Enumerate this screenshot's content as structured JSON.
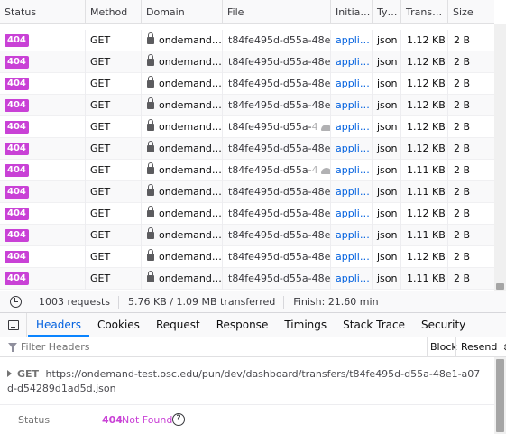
{
  "columns": {
    "status": "Status",
    "method": "Method",
    "domain": "Domain",
    "file": "File",
    "initiator": "Initia…",
    "type": "Ty…",
    "transferred": "Trans…",
    "size": "Size"
  },
  "rows": [
    {
      "status": "404",
      "method": "GET",
      "domain": "ondemand…",
      "file": "t84fe495d-d55a-48e1-",
      "initiator": "appli…",
      "type": "json",
      "transferred": "1.12 KB",
      "size": "2 B"
    },
    {
      "status": "404",
      "method": "GET",
      "domain": "ondemand…",
      "file": "t84fe495d-d55a-48e1-",
      "initiator": "appli…",
      "type": "json",
      "transferred": "1.12 KB",
      "size": "2 B"
    },
    {
      "status": "404",
      "method": "GET",
      "domain": "ondemand…",
      "file": "t84fe495d-d55a-48e1-",
      "initiator": "appli…",
      "type": "json",
      "transferred": "1.12 KB",
      "size": "2 B"
    },
    {
      "status": "404",
      "method": "GET",
      "domain": "ondemand…",
      "file": "t84fe495d-d55a-48e1-",
      "initiator": "appli…",
      "type": "json",
      "transferred": "1.12 KB",
      "size": "2 B"
    },
    {
      "status": "404",
      "method": "GET",
      "domain": "ondemand…",
      "file": "t84fe495d-d55a-",
      "file_faded": "4",
      "initiator": "appli…",
      "type": "json",
      "transferred": "1.12 KB",
      "size": "2 B"
    },
    {
      "status": "404",
      "method": "GET",
      "domain": "ondemand…",
      "file": "t84fe495d-d55a-48e1-",
      "initiator": "appli…",
      "type": "json",
      "transferred": "1.12 KB",
      "size": "2 B"
    },
    {
      "status": "404",
      "method": "GET",
      "domain": "ondemand…",
      "file": "t84fe495d-d55a-",
      "file_faded": "4",
      "initiator": "appli…",
      "type": "json",
      "transferred": "1.11 KB",
      "size": "2 B"
    },
    {
      "status": "404",
      "method": "GET",
      "domain": "ondemand…",
      "file": "t84fe495d-d55a-48e1-",
      "initiator": "appli…",
      "type": "json",
      "transferred": "1.11 KB",
      "size": "2 B"
    },
    {
      "status": "404",
      "method": "GET",
      "domain": "ondemand…",
      "file": "t84fe495d-d55a-48e1-",
      "initiator": "appli…",
      "type": "json",
      "transferred": "1.12 KB",
      "size": "2 B"
    },
    {
      "status": "404",
      "method": "GET",
      "domain": "ondemand…",
      "file": "t84fe495d-d55a-48e1-",
      "initiator": "appli…",
      "type": "json",
      "transferred": "1.11 KB",
      "size": "2 B"
    },
    {
      "status": "404",
      "method": "GET",
      "domain": "ondemand…",
      "file": "t84fe495d-d55a-48e1-",
      "initiator": "appli…",
      "type": "json",
      "transferred": "1.12 KB",
      "size": "2 B"
    },
    {
      "status": "404",
      "method": "GET",
      "domain": "ondemand…",
      "file": "t84fe495d-d55a-48e1-",
      "initiator": "appli…",
      "type": "json",
      "transferred": "1.11 KB",
      "size": "2 B"
    }
  ],
  "summary": {
    "requests": "1003 requests",
    "transferred": "5.76 KB / 1.09 MB transferred",
    "finish": "Finish: 21.60 min"
  },
  "tabs": [
    "Headers",
    "Cookies",
    "Request",
    "Response",
    "Timings",
    "Stack Trace",
    "Security"
  ],
  "active_tab": "Headers",
  "filter": {
    "placeholder": "Filter Headers",
    "value": ""
  },
  "actions": {
    "block": "Block",
    "resend": "Resend"
  },
  "request": {
    "method": "GET",
    "url": "https://ondemand-test.osc.edu/pun/dev/dashboard/transfers/t84fe495d-d55a-48e1-a07d-d54289d1ad5d.json"
  },
  "status": {
    "label": "Status",
    "code": "404",
    "text": "Not Found",
    "help": "?"
  },
  "colors": {
    "status_error": "#c941d6",
    "accent": "#0a84ff",
    "initiator_link": "#0060df"
  },
  "icons": [
    "lock-icon",
    "turtle-icon",
    "clock-icon",
    "panel-toggle-icon",
    "filter-icon",
    "twisty-icon",
    "help-icon",
    "dropdown-arrows-icon"
  ]
}
